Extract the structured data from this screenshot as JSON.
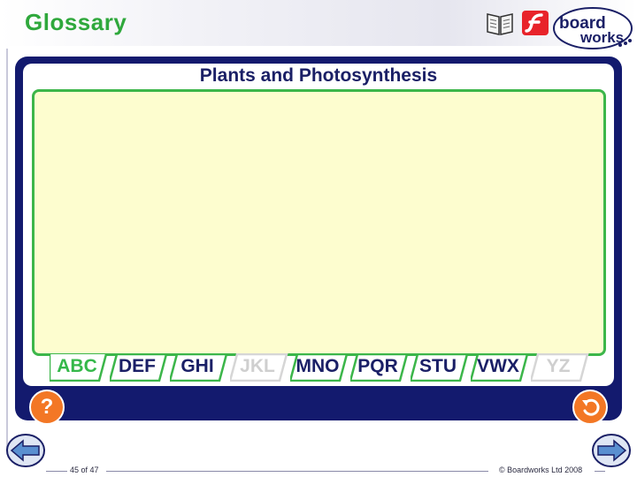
{
  "header": {
    "title": "Glossary",
    "icons": [
      "book-icon",
      "flash-icon"
    ],
    "logo_line1": "board",
    "logo_line2": "works"
  },
  "panel": {
    "title": "Plants and Photosynthesis",
    "content_text": ""
  },
  "tabs": [
    {
      "label": "ABC",
      "state": "active"
    },
    {
      "label": "DEF",
      "state": "enabled"
    },
    {
      "label": "GHI",
      "state": "enabled"
    },
    {
      "label": "JKL",
      "state": "disabled"
    },
    {
      "label": "MNO",
      "state": "enabled"
    },
    {
      "label": "PQR",
      "state": "enabled"
    },
    {
      "label": "STU",
      "state": "enabled"
    },
    {
      "label": "VWX",
      "state": "enabled"
    },
    {
      "label": "YZ",
      "state": "disabled"
    }
  ],
  "buttons": {
    "help_label": "?",
    "back_icon": "return-arrow-icon"
  },
  "footer": {
    "slide_number": "45 of 47",
    "copyright": "© Boardworks Ltd 2008",
    "prev_icon": "arrow-left-icon",
    "next_icon": "arrow-right-icon"
  },
  "colors": {
    "title_green": "#2fa83c",
    "panel_navy": "#131a6e",
    "content_yellow": "#fdfdcf",
    "border_green": "#3cb64a",
    "button_orange": "#f37725"
  }
}
